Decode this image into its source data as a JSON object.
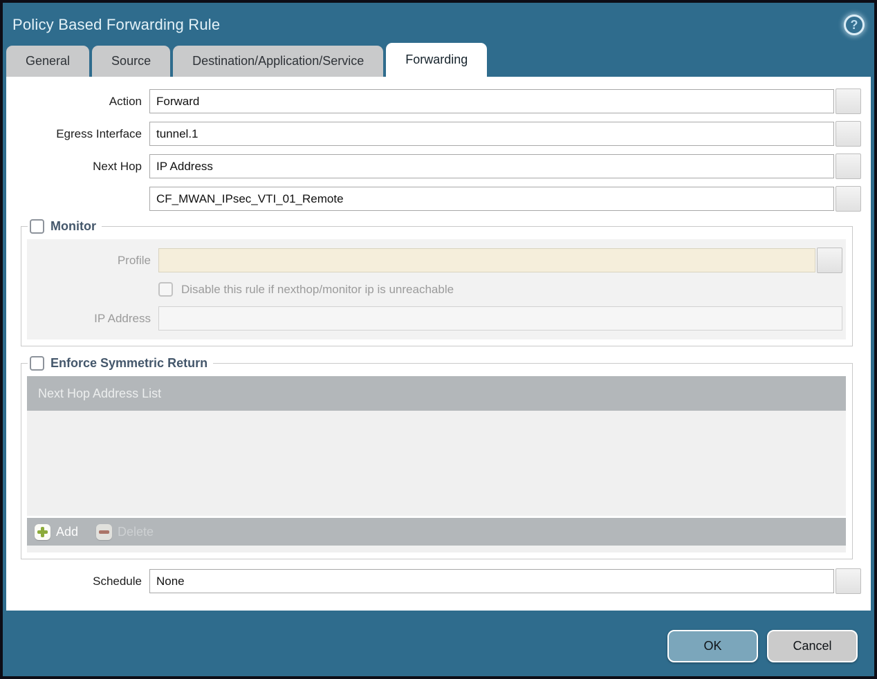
{
  "dialog": {
    "title": "Policy Based Forwarding Rule"
  },
  "icons": {
    "help_glyph": "?"
  },
  "tabs": [
    {
      "label": "General",
      "active": false
    },
    {
      "label": "Source",
      "active": false
    },
    {
      "label": "Destination/Application/Service",
      "active": false
    },
    {
      "label": "Forwarding",
      "active": true
    }
  ],
  "form": {
    "action": {
      "label": "Action",
      "value": "Forward"
    },
    "egress_interface": {
      "label": "Egress Interface",
      "value": "tunnel.1"
    },
    "next_hop": {
      "label": "Next Hop",
      "value": "IP Address"
    },
    "next_hop_address": {
      "value": "CF_MWAN_IPsec_VTI_01_Remote"
    },
    "schedule": {
      "label": "Schedule",
      "value": "None"
    }
  },
  "monitor": {
    "legend": "Monitor",
    "checked": false,
    "profile": {
      "label": "Profile",
      "value": ""
    },
    "disable_rule": {
      "label": "Disable this rule if nexthop/monitor ip is unreachable",
      "checked": false
    },
    "ip_address": {
      "label": "IP Address",
      "value": ""
    }
  },
  "symmetric_return": {
    "legend": "Enforce Symmetric Return",
    "checked": false,
    "table": {
      "header": "Next Hop Address List",
      "rows": []
    },
    "add_label": "Add",
    "delete_label": "Delete"
  },
  "footer": {
    "ok_label": "OK",
    "cancel_label": "Cancel"
  },
  "colors": {
    "titlebar_teal": "#2f6c8d",
    "active_tab_bg": "#ffffff",
    "inactive_tab_bg": "#c9cacb",
    "legend_text": "#44576b",
    "disabled_field_beige": "#f5eedb",
    "table_bar_gray": "#b3b7ba",
    "ok_button_blue": "#7ba6bb",
    "cancel_button_gray": "#cbcbcb",
    "add_icon_green": "#8cab3a",
    "delete_icon_red": "#a9604f"
  }
}
